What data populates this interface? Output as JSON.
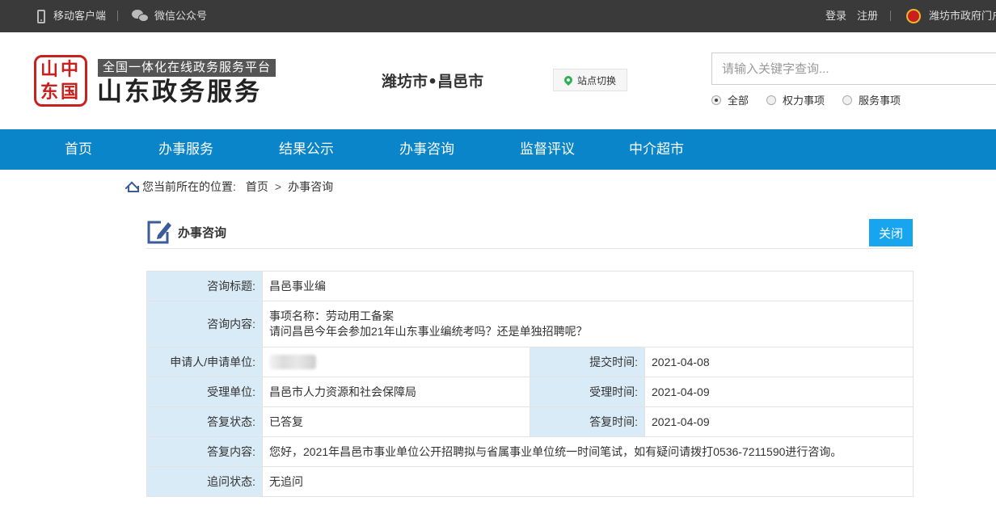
{
  "topbar": {
    "mobile_client": "移动客户端",
    "wechat": "微信公众号",
    "login": "登录",
    "register": "注册",
    "portal": "潍坊市政府门户"
  },
  "header": {
    "seal_chars": [
      "中",
      "国",
      "山",
      "东"
    ],
    "slogan": "全国一体化在线政务服务平台",
    "brand": "山东政务服务",
    "city": "潍坊市•昌邑市",
    "site_switch": "站点切换",
    "search_placeholder": "请输入关键字查询...",
    "search_options": [
      "全部",
      "权力事项",
      "服务事项"
    ],
    "search_selected": "全部"
  },
  "nav": {
    "items": [
      "首页",
      "办事服务",
      "结果公示",
      "办事咨询",
      "监督评议",
      "中介超市"
    ]
  },
  "breadcrumb": {
    "prefix": "您当前所在的位置:",
    "home": "首页",
    "separator": ">",
    "current": "办事咨询"
  },
  "panel": {
    "title": "办事咨询",
    "close": "关闭"
  },
  "detail": {
    "title_label": "咨询标题:",
    "title_value": "昌邑事业编",
    "content_label": "咨询内容:",
    "content_line1": "事项名称：劳动用工备案",
    "content_line2": "请问昌邑今年会参加21年山东事业编统考吗？还是单独招聘呢？",
    "applicant_label": "申请人/申请单位:",
    "submit_time_label": "提交时间:",
    "submit_time": "2021-04-08",
    "dept_label": "受理单位:",
    "dept_value": "昌邑市人力资源和社会保障局",
    "accept_time_label": "受理时间:",
    "accept_time": "2021-04-09",
    "reply_status_label": "答复状态:",
    "reply_status": "已答复",
    "reply_time_label": "答复时间:",
    "reply_time": "2021-04-09",
    "reply_content_label": "答复内容:",
    "reply_content": "您好，2021年昌邑市事业单位公开招聘拟与省属事业单位统一时间笔试，如有疑问请拨打0536-7211590进行咨询。",
    "follow_status_label": "追问状态:",
    "follow_status": "无追问"
  }
}
